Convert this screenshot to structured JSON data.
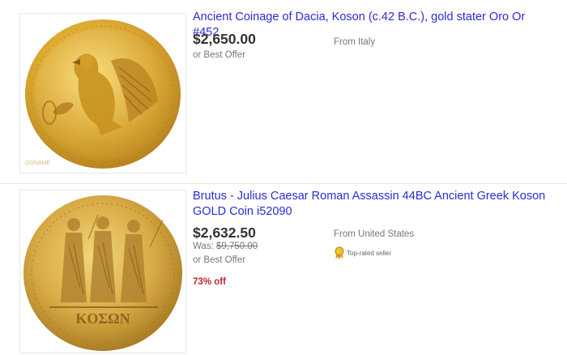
{
  "listings": [
    {
      "title": "Ancient Coinage of Dacia, Koson (c.42 B.C.), gold stater Oro Or #452",
      "price": "$2,650.00",
      "best_offer": "or Best Offer",
      "location": "From Italy",
      "watermark": "GGNAME"
    },
    {
      "title": "Brutus - Julius Caesar Roman Assassin 44BC Ancient Greek Koson GOLD Coin i52090",
      "price": "$2,632.50",
      "was_label": "Was:",
      "was_price": "$9,750.00",
      "best_offer": "or Best Offer",
      "location": "From United States",
      "top_rated": "Top-rated seller",
      "discount": "73% off",
      "coin_legend": "KOΣΩN"
    }
  ],
  "colors": {
    "link": "#2b2bd4",
    "discount": "#c0282f",
    "gold": "#d9aa35"
  },
  "icons": {
    "top_rated": "gold-ribbon-icon"
  }
}
